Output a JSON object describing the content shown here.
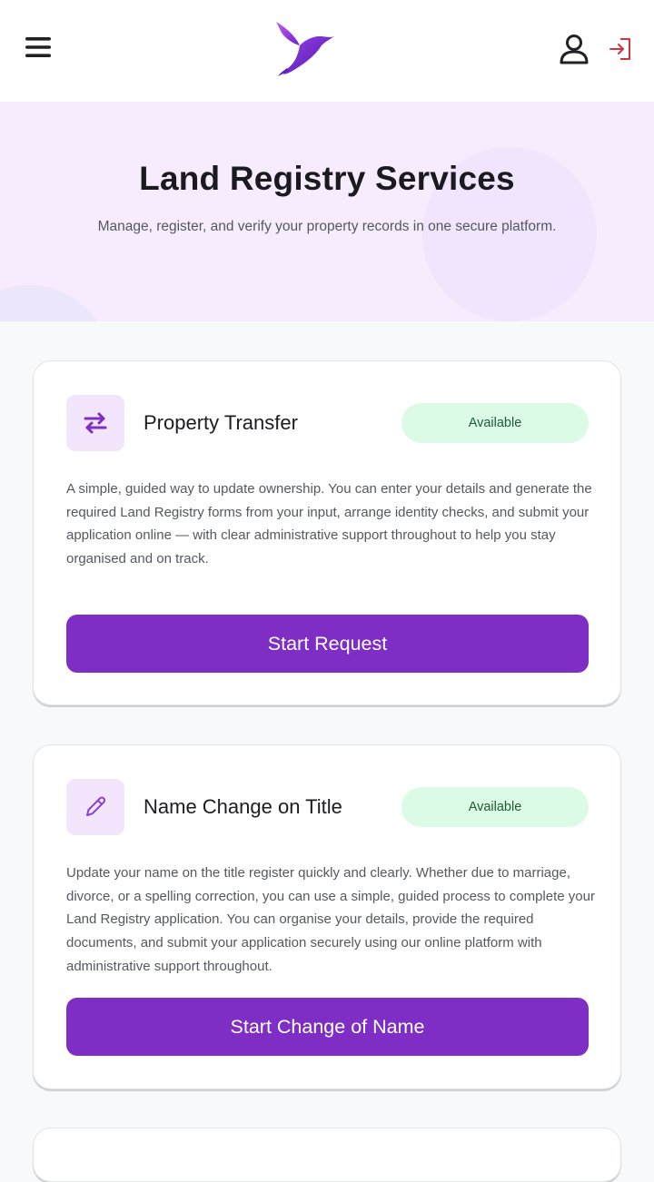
{
  "header": {
    "menu_icon": "hamburger-menu-icon",
    "logo_icon": "hummingbird-logo-icon",
    "user_icon": "user-account-icon",
    "login_icon": "sign-in-icon"
  },
  "hero": {
    "title": "Land Registry Services",
    "subtitle": "Manage, register, and verify your property records in one secure platform."
  },
  "services": [
    {
      "icon": "swap-arrows-icon",
      "title": "Property Transfer",
      "status": "Available",
      "description": "A simple, guided way to update ownership. You can enter your details and generate the required Land Registry forms from your input, arrange identity checks, and submit your application online — with clear administrative support throughout to help you stay organised and on track.",
      "button_label": "Start Request"
    },
    {
      "icon": "pencil-edit-icon",
      "title": "Name Change on Title",
      "status": "Available",
      "description": "Update your name on the title register quickly and clearly. Whether due to marriage, divorce, or a spelling correction, you can use a simple, guided process to complete your Land Registry application. You can organise your details, provide the required documents, and submit your application securely using our online platform with administrative support throughout.",
      "button_label": "Start Change of Name"
    }
  ],
  "colors": {
    "brand_purple": "#7f2ec5",
    "hero_bg": "#f7ecfd",
    "badge_bg": "#dcfbe6",
    "badge_text": "#1d5b35",
    "login_icon": "#d0353f"
  }
}
